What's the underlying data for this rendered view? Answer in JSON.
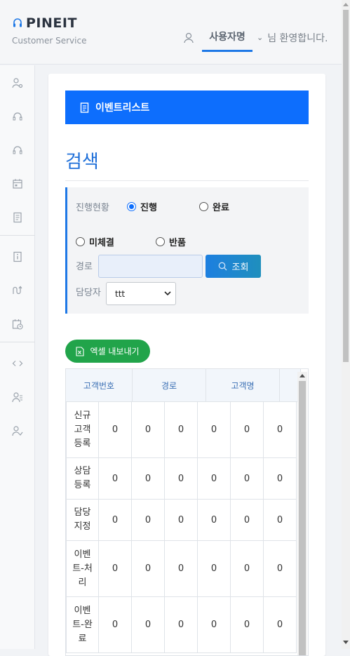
{
  "brand": {
    "title": "PINEIT",
    "subtitle": "Customer Service"
  },
  "user": {
    "name": "사용자명",
    "greeting": "님 환영합니다."
  },
  "banner": {
    "label": "이벤트리스트"
  },
  "search": {
    "title": "검색",
    "status_label": "진행현황",
    "status_options": [
      {
        "label": "진행",
        "checked": true
      },
      {
        "label": "완료",
        "checked": false
      },
      {
        "label": "미체결",
        "checked": false
      },
      {
        "label": "반품",
        "checked": false
      }
    ],
    "route_label": "경로",
    "route_value": "",
    "search_button": "조회",
    "manager_label": "담당자",
    "manager_selected": "ttt"
  },
  "excel_button": "엑셀 내보내기",
  "table": {
    "headers": [
      "고객번호",
      "경로",
      "고객명"
    ],
    "rows": [
      {
        "label": "신규\n고객\n등록",
        "values": [
          "0",
          "0",
          "0",
          "0",
          "0",
          "0"
        ]
      },
      {
        "label": "상담\n등록",
        "values": [
          "0",
          "0",
          "0",
          "0",
          "0",
          "0"
        ]
      },
      {
        "label": "담당\n지정",
        "values": [
          "0",
          "0",
          "0",
          "0",
          "0",
          "0"
        ]
      },
      {
        "label": "이벤\n트-처\n리",
        "values": [
          "0",
          "0",
          "0",
          "0",
          "0",
          "0"
        ]
      },
      {
        "label": "이벤\n트-완\n료",
        "values": [
          "0",
          "0",
          "0",
          "0",
          "0",
          "0"
        ]
      }
    ]
  },
  "sidebar_icons": [
    "user-gear-icon",
    "headset-icon",
    "headset-icon",
    "calendar-icon",
    "document-icon",
    "info-icon",
    "route-icon",
    "calendar-clock-icon",
    "code-icon",
    "user-list-icon",
    "user-check-icon"
  ],
  "colors": {
    "accent": "#0d6efd",
    "title": "#1e6fd9",
    "excel": "#21a44a"
  }
}
